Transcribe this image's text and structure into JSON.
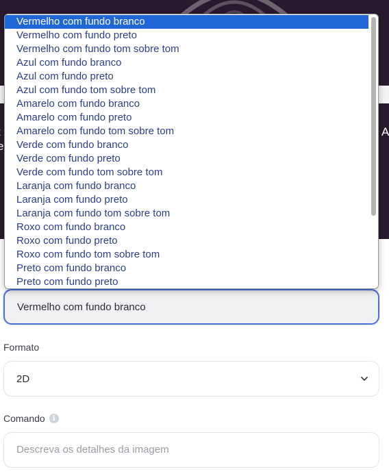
{
  "colors": {
    "header_bg": "#2a1a2f",
    "selected_option_bg": "#1f66d6",
    "focus_border": "#4c6fd8",
    "option_text": "#2c3e8a"
  },
  "background": {
    "left_edge_fragments": [
      "t",
      "e"
    ],
    "right_edge_fragment": "A"
  },
  "style_dropdown": {
    "selected_index": 0,
    "options": [
      "Vermelho com fundo branco",
      "Vermelho com fundo preto",
      "Vermelho com fundo tom sobre tom",
      "Azul com fundo branco",
      "Azul com fundo preto",
      "Azul com fundo tom sobre tom",
      "Amarelo com fundo branco",
      "Amarelo com fundo preto",
      "Amarelo com fundo tom sobre tom",
      "Verde com fundo branco",
      "Verde com fundo preto",
      "Verde com fundo tom sobre tom",
      "Laranja com fundo branco",
      "Laranja com fundo preto",
      "Laranja com fundo tom sobre tom",
      "Roxo com fundo branco",
      "Roxo com fundo preto",
      "Roxo com fundo tom sobre tom",
      "Preto com fundo branco",
      "Preto com fundo preto"
    ],
    "value": "Vermelho com fundo branco"
  },
  "format_field": {
    "label": "Formato",
    "value": "2D",
    "icon": "chevron-down-icon"
  },
  "command_field": {
    "label": "Comando",
    "placeholder": "Descreva os detalhes da imagem",
    "info_glyph": "i",
    "icon": "info-icon"
  }
}
